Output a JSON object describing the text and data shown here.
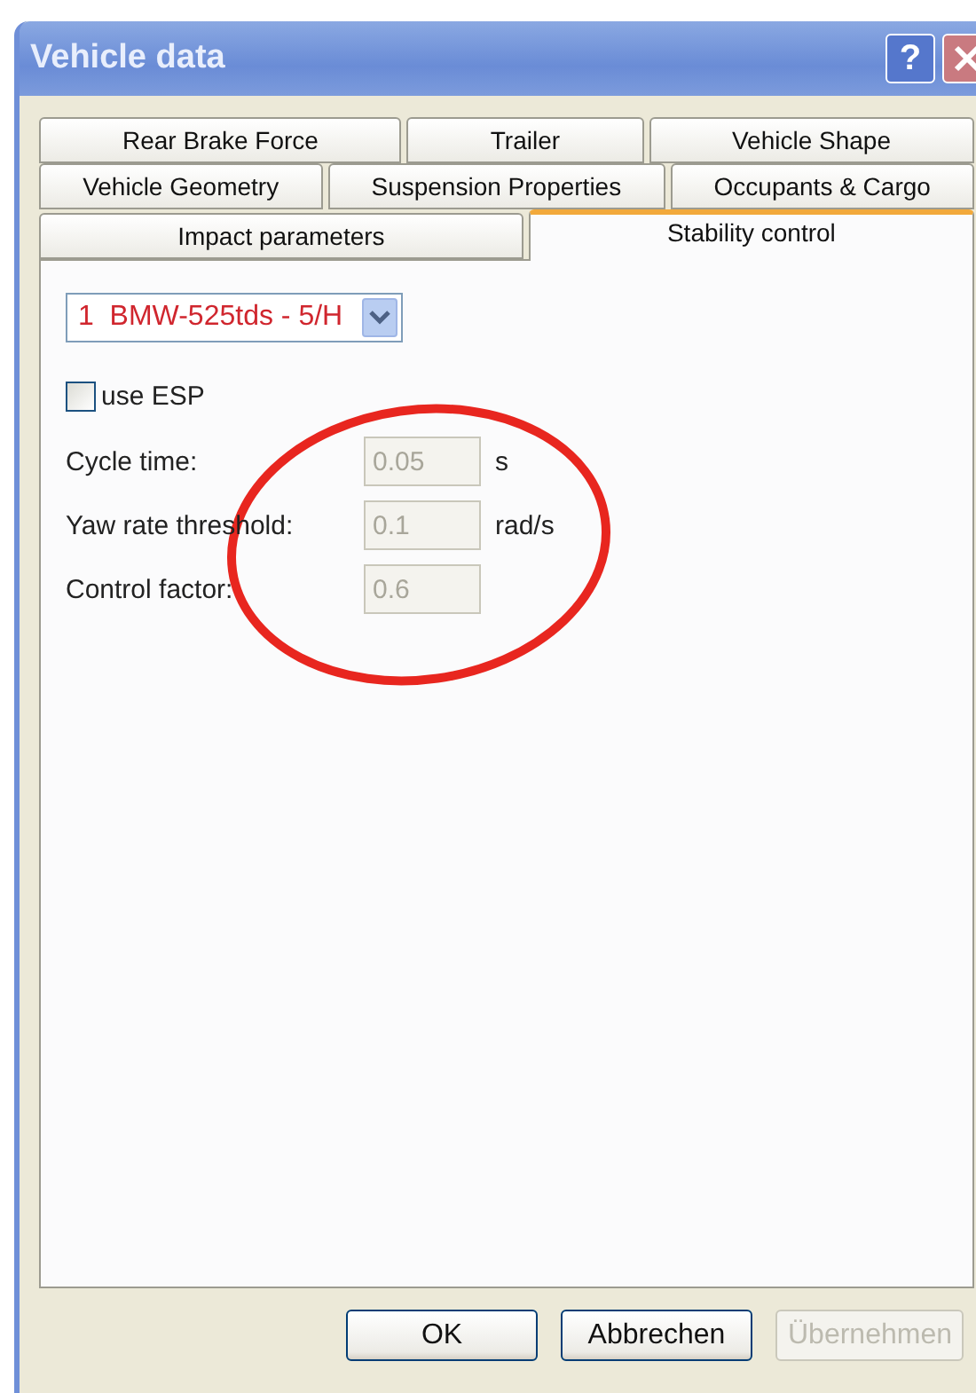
{
  "window": {
    "title": "Vehicle data",
    "help": "?"
  },
  "tab_rows": [
    [
      {
        "label": "Rear Brake Force",
        "selected": false
      },
      {
        "label": "Trailer",
        "selected": false
      },
      {
        "label": "Vehicle Shape",
        "selected": false
      }
    ],
    [
      {
        "label": "Vehicle Geometry",
        "selected": false
      },
      {
        "label": "Suspension Properties",
        "selected": false
      },
      {
        "label": "Occupants & Cargo",
        "selected": false
      }
    ],
    [
      {
        "label": "Impact parameters",
        "selected": false
      },
      {
        "label": "Stability control",
        "selected": true
      }
    ]
  ],
  "vehicle_select": {
    "value": "1  BMW-525tds - 5/H"
  },
  "esp_checkbox": {
    "label": "use ESP",
    "checked": false
  },
  "fields": [
    {
      "label": "Cycle time:",
      "value": "0.05",
      "unit": "s",
      "disabled": true
    },
    {
      "label": "Yaw rate threshold:",
      "value": "0.1",
      "unit": "rad/s",
      "disabled": true
    },
    {
      "label": "Control factor:",
      "value": "0.6",
      "disabled": true
    }
  ],
  "buttons": [
    {
      "label": "OK",
      "disabled": false
    },
    {
      "label": "Abbrechen",
      "disabled": false
    },
    {
      "label": "Übernehmen",
      "disabled": true
    }
  ],
  "annotation": {
    "kind": "ellipse",
    "color": "#e8261f"
  }
}
